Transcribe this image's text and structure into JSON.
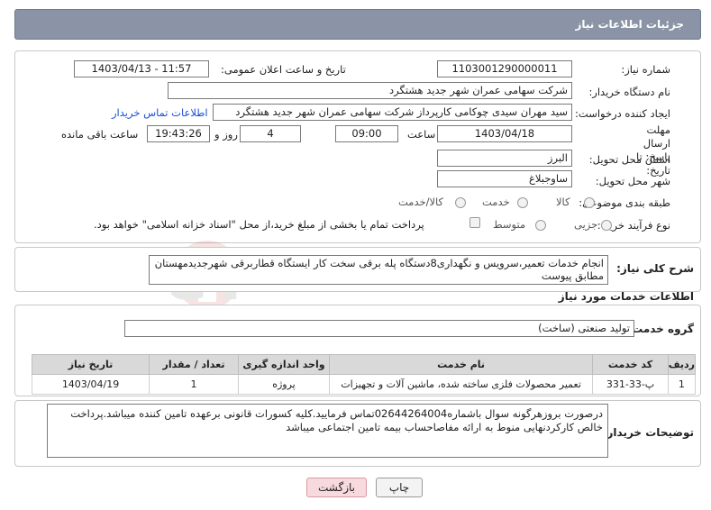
{
  "header": {
    "title": "جزئیات اطلاعات نیاز"
  },
  "fields": {
    "need_number_label": "شماره نیاز:",
    "need_number": "1103001290000011",
    "announce_label": "تاریخ و ساعت اعلان عمومی:",
    "announce_value": "1403/04/13 - 11:57",
    "buyer_org_label": "نام دستگاه خریدار:",
    "buyer_org": "شرکت سهامی عمران شهر جدید هشتگرد",
    "requester_label": "ایجاد کننده درخواست:",
    "requester": "سید مهران سیدی چوکامی کارپرداز شرکت سهامی عمران شهر جدید هشتگرد",
    "contact_link": "اطلاعات تماس خریدار",
    "deadline_label": "مهلت ارسال پاسخ: تا تاریخ:",
    "deadline_date": "1403/04/18",
    "time_label": "ساعت",
    "deadline_time": "09:00",
    "days_value": "4",
    "days_label": "روز و",
    "remaining_time": "19:43:26",
    "remaining_label": "ساعت باقی مانده",
    "province_label": "استان محل تحویل:",
    "province": "البرز",
    "city_label": "شهر محل تحویل:",
    "city": "ساوجبلاغ",
    "category_label": "طبقه بندی موضوعی:",
    "category_options": [
      "کالا",
      "خدمت",
      "کالا/خدمت"
    ],
    "process_label": "نوع فرآیند خرید :",
    "process_options": [
      "جزیی",
      "متوسط"
    ],
    "payment_note": "پرداخت تمام یا بخشی از مبلغ خرید،از محل \"اسناد خزانه اسلامی\" خواهد بود."
  },
  "summary": {
    "label": "شرح کلی نیاز:",
    "text": "انجام خدمات تعمیر،سرویس و نگهداری8دستگاه پله برقی سخت کار ایستگاه قطاربرقی شهرجدیدمهستان مطابق پیوست"
  },
  "services": {
    "section_title": "اطلاعات خدمات مورد نیاز",
    "group_label": "گروه خدمت:",
    "group_value": "تولید صنعتی (ساخت)",
    "columns": [
      "ردیف",
      "کد خدمت",
      "نام خدمت",
      "واحد اندازه گیری",
      "تعداد / مقدار",
      "تاریخ نیاز"
    ],
    "rows": [
      [
        "1",
        "پ-33-331",
        "تعمیر محصولات فلزی ساخته شده، ماشین آلات و تجهیزات",
        "پروژه",
        "1",
        "1403/04/19"
      ]
    ]
  },
  "buyer_notes": {
    "label": "توضیحات خریدار:",
    "text": "درصورت بروزهرگونه سوال باشماره02644264004تماس فرمایید.کلیه کسورات قانونی برعهده تامین کننده میباشد.پرداخت خالص کارکردنهایی منوط به ارائه مفاصاحساب بیمه تامین اجتماعی میباشد"
  },
  "buttons": {
    "print": "چاپ",
    "back": "بازگشت"
  },
  "watermark": {
    "text": "AriaTender.neT"
  },
  "colors": {
    "header": "#8a94a6",
    "link": "#1a4fd6",
    "back_button": "#f7d9de"
  }
}
